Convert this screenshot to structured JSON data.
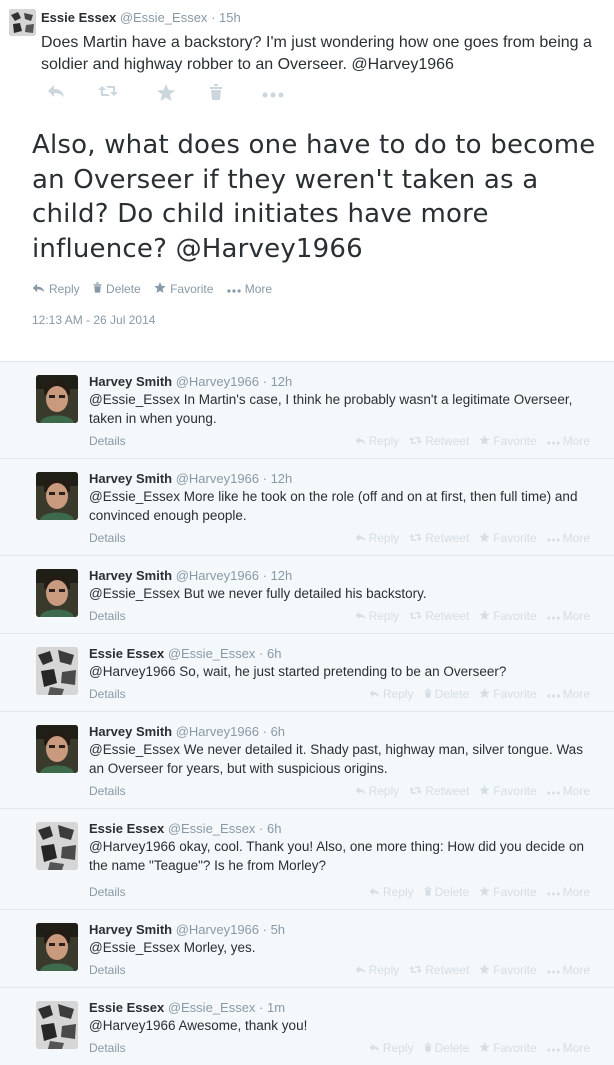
{
  "parent_tweet": {
    "author_name": "Essie Essex",
    "author_handle": "@Essie_Essex",
    "time": "15h",
    "text": "Does Martin have a backstory? I'm just wondering how one goes from being a soldier and highway robber to an Overseer. @Harvey1966",
    "actions": [
      "reply-icon",
      "retweet-icon",
      "favorite-icon",
      "delete-icon",
      "more-icon"
    ]
  },
  "main_tweet": {
    "text": "Also, what does one have to do to become an Overseer if they weren't taken as a child? Do child initiates have more influence? @Harvey1966",
    "actions": {
      "reply": "Reply",
      "delete": "Delete",
      "favorite": "Favorite",
      "more": "More"
    },
    "timestamp": "12:13 AM - 26 Jul 2014"
  },
  "replies": [
    {
      "author": "harvey",
      "name": "Harvey Smith",
      "handle": "@Harvey1966",
      "time": "12h",
      "text": "@Essie_Essex In Martin's case, I think he probably wasn't a legitimate Overseer, taken in when young.",
      "details": "Details",
      "actions": [
        "Reply",
        "Retweet",
        "Favorite",
        "More"
      ]
    },
    {
      "author": "harvey",
      "name": "Harvey Smith",
      "handle": "@Harvey1966",
      "time": "12h",
      "text": "@Essie_Essex More like he took on the role (off and on at first, then full time) and convinced enough people.",
      "details": "Details",
      "actions": [
        "Reply",
        "Retweet",
        "Favorite",
        "More"
      ]
    },
    {
      "author": "harvey",
      "name": "Harvey Smith",
      "handle": "@Harvey1966",
      "time": "12h",
      "text": "@Essie_Essex But we never fully detailed his backstory.",
      "details": "Details",
      "actions": [
        "Reply",
        "Retweet",
        "Favorite",
        "More"
      ]
    },
    {
      "author": "essie",
      "name": "Essie Essex",
      "handle": "@Essie_Essex",
      "time": "6h",
      "text": "@Harvey1966 So, wait, he just started pretending to be an Overseer?",
      "details": "Details",
      "actions": [
        "Reply",
        "Delete",
        "Favorite",
        "More"
      ]
    },
    {
      "author": "harvey",
      "name": "Harvey Smith",
      "handle": "@Harvey1966",
      "time": "6h",
      "text": "@Essie_Essex We never detailed it. Shady past, highway man, silver tongue. Was an Overseer for years, but with suspicious origins.",
      "details": "Details",
      "actions": [
        "Reply",
        "Retweet",
        "Favorite",
        "More"
      ]
    },
    {
      "author": "essie",
      "name": "Essie Essex",
      "handle": "@Essie_Essex",
      "time": "6h",
      "text": "@Harvey1966 okay, cool. Thank you! Also, one more thing: How did you decide on the name \"Teague\"? Is he from Morley?",
      "details": "Details",
      "actions": [
        "Reply",
        "Delete",
        "Favorite",
        "More"
      ]
    },
    {
      "author": "harvey",
      "name": "Harvey Smith",
      "handle": "@Harvey1966",
      "time": "5h",
      "text": "@Essie_Essex Morley, yes.",
      "details": "Details",
      "actions": [
        "Reply",
        "Retweet",
        "Favorite",
        "More"
      ]
    },
    {
      "author": "essie",
      "name": "Essie Essex",
      "handle": "@Essie_Essex",
      "time": "1m",
      "text": "@Harvey1966 Awesome, thank you!",
      "details": "Details",
      "actions": [
        "Reply",
        "Delete",
        "Favorite",
        "More"
      ]
    }
  ],
  "colors": {
    "text": "#292f33",
    "muted": "#8899a6",
    "faint_action": "#d4dee4",
    "reply_bg": "#f5f8fa",
    "border": "#e1e8ed"
  }
}
